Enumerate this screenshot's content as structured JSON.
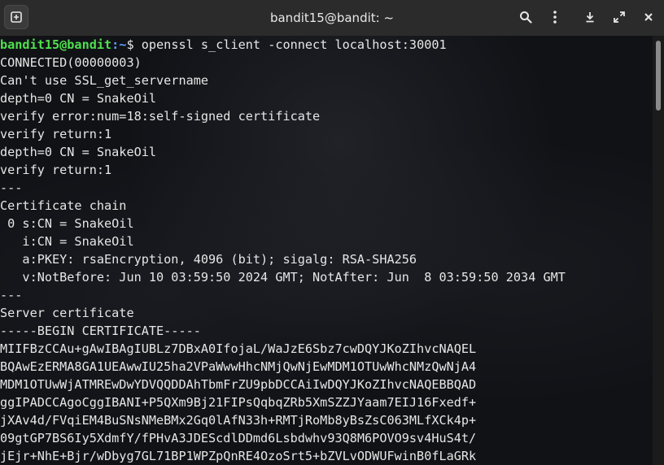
{
  "window": {
    "title": "bandit15@bandit: ~",
    "buttons": {
      "new_tab": "new-tab-icon",
      "search": "search-icon",
      "menu": "kebab-menu-icon",
      "minimize": "minimize-icon",
      "maximize": "maximize-icon",
      "close": "close-icon"
    }
  },
  "prompt": {
    "user_host": "bandit15@bandit",
    "path": ":~",
    "symbol": "$",
    "command": " openssl s_client -connect localhost:30001"
  },
  "output_lines": [
    "CONNECTED(00000003)",
    "Can't use SSL_get_servername",
    "depth=0 CN = SnakeOil",
    "verify error:num=18:self-signed certificate",
    "verify return:1",
    "depth=0 CN = SnakeOil",
    "verify return:1",
    "---",
    "Certificate chain",
    " 0 s:CN = SnakeOil",
    "   i:CN = SnakeOil",
    "   a:PKEY: rsaEncryption, 4096 (bit); sigalg: RSA-SHA256",
    "   v:NotBefore: Jun 10 03:59:50 2024 GMT; NotAfter: Jun  8 03:59:50 2034 GMT",
    "---",
    "Server certificate",
    "-----BEGIN CERTIFICATE-----",
    "MIIFBzCCAu+gAwIBAgIUBLz7DBxA0IfojaL/WaJzE6Sbz7cwDQYJKoZIhvcNAQEL",
    "BQAwEzERMA8GA1UEAwwIU25ha2VPaWwwHhcNMjQwNjEwMDM1OTUwWhcNMzQwNjA4",
    "MDM1OTUwWjATMREwDwYDVQQDDAhTbmFrZU9pbDCCAiIwDQYJKoZIhvcNAQEBBQAD",
    "ggIPADCCAgoCggIBANI+P5QXm9Bj21FIPsQqbqZRb5XmSZZJYaam7EIJ16Fxedf+",
    "jXAv4d/FVqiEM4BuSNsNMeBMx2Gq0lAfN33h+RMTjRoMb8yBsZsC063MLfXCk4p+",
    "09gtGP7BS6Iy5XdmfY/fPHvA3JDEScdlDDmd6Lsbdwhv93Q8M6POVO9sv4HuS4t/",
    "jEjr+NhE+Bjr/wDbyg7GL71BP1WPZpQnRE4OzoSrt5+bZVLvODWUFwinB0fLaGRk"
  ]
}
